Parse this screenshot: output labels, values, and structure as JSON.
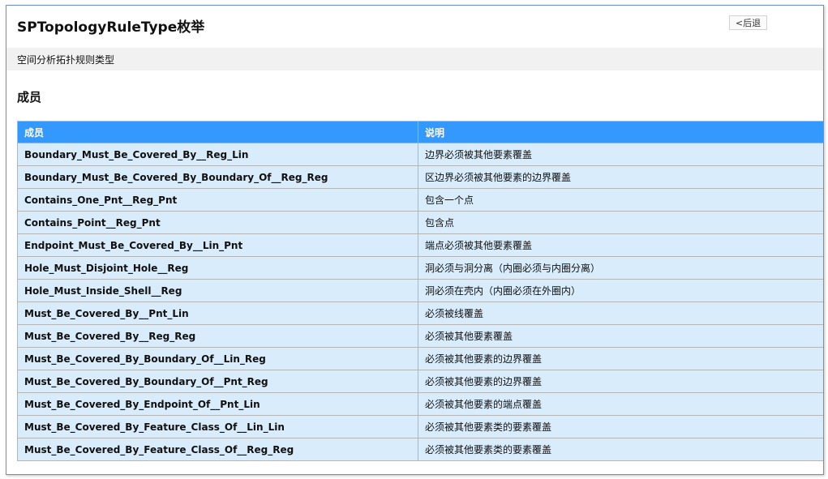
{
  "page": {
    "title": "SPTopologyRuleType枚举",
    "back_label": "<后退",
    "description": "空间分析拓扑规则类型",
    "section_title": "成员"
  },
  "table": {
    "headers": [
      "成员",
      "说明"
    ],
    "rows": [
      {
        "member": "Boundary_Must_Be_Covered_By__Reg_Lin",
        "desc": "边界必须被其他要素覆盖"
      },
      {
        "member": "Boundary_Must_Be_Covered_By_Boundary_Of__Reg_Reg",
        "desc": "区边界必须被其他要素的边界覆盖"
      },
      {
        "member": "Contains_One_Pnt__Reg_Pnt",
        "desc": "包含一个点"
      },
      {
        "member": "Contains_Point__Reg_Pnt",
        "desc": "包含点"
      },
      {
        "member": "Endpoint_Must_Be_Covered_By__Lin_Pnt",
        "desc": "端点必须被其他要素覆盖"
      },
      {
        "member": "Hole_Must_Disjoint_Hole__Reg",
        "desc": "洞必须与洞分离（内圈必须与内圈分离）"
      },
      {
        "member": "Hole_Must_Inside_Shell__Reg",
        "desc": "洞必须在壳内（内圈必须在外圈内）"
      },
      {
        "member": "Must_Be_Covered_By__Pnt_Lin",
        "desc": "必须被线覆盖"
      },
      {
        "member": "Must_Be_Covered_By__Reg_Reg",
        "desc": "必须被其他要素覆盖"
      },
      {
        "member": "Must_Be_Covered_By_Boundary_Of__Lin_Reg",
        "desc": "必须被其他要素的边界覆盖"
      },
      {
        "member": "Must_Be_Covered_By_Boundary_Of__Pnt_Reg",
        "desc": "必须被其他要素的边界覆盖"
      },
      {
        "member": "Must_Be_Covered_By_Endpoint_Of__Pnt_Lin",
        "desc": "必须被其他要素的端点覆盖"
      },
      {
        "member": "Must_Be_Covered_By_Feature_Class_Of__Lin_Lin",
        "desc": "必须被其他要素类的要素覆盖"
      },
      {
        "member": "Must_Be_Covered_By_Feature_Class_Of__Reg_Reg",
        "desc": "必须被其他要素类的要素覆盖"
      }
    ]
  },
  "colors": {
    "header_bg": "#3399ff",
    "row_bg": "#d9ecfb",
    "desc_bar_bg": "#f1f1f1",
    "frame_border": "#6f8fc8"
  }
}
